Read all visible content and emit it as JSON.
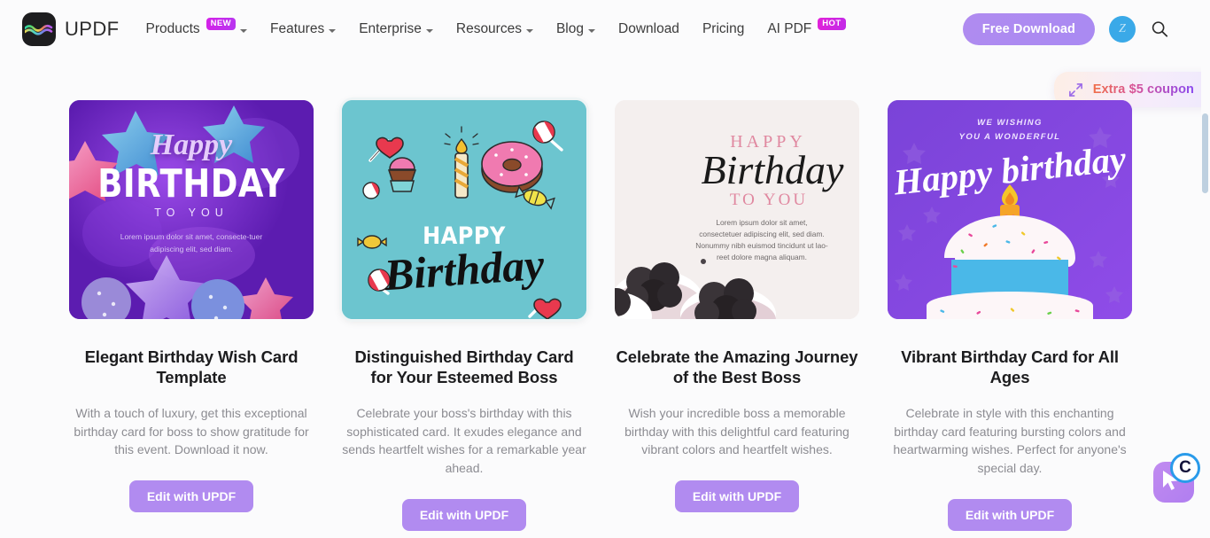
{
  "header": {
    "brand_name": "UPDF",
    "logo_icon": "updf-logo-icon",
    "nav": [
      {
        "label": "Products",
        "badge": "NEW",
        "badge_type": "new",
        "has_caret": true
      },
      {
        "label": "Features",
        "badge": null,
        "badge_type": null,
        "has_caret": true
      },
      {
        "label": "Enterprise",
        "badge": null,
        "badge_type": null,
        "has_caret": true
      },
      {
        "label": "Resources",
        "badge": null,
        "badge_type": null,
        "has_caret": true
      },
      {
        "label": "Blog",
        "badge": null,
        "badge_type": null,
        "has_caret": true
      },
      {
        "label": "Download",
        "badge": null,
        "badge_type": null,
        "has_caret": false
      },
      {
        "label": "Pricing",
        "badge": null,
        "badge_type": null,
        "has_caret": false
      },
      {
        "label": "AI PDF",
        "badge": "HOT",
        "badge_type": "hot",
        "has_caret": false
      }
    ],
    "download_button": "Free Download",
    "avatar_initial": "Z",
    "search_icon": "search-icon",
    "accent_purple": "#b08bf0",
    "avatar_blue": "#3aa9e8"
  },
  "coupon": {
    "label": "Extra $5 coupon",
    "icon": "expand-arrows-icon"
  },
  "cards": [
    {
      "title": "Elegant Birthday Wish Card Template",
      "description": "With a touch of luxury, get this exceptional birthday card for boss to show gratitude for this event. Download it now.",
      "button": "Edit with UPDF",
      "selected": false,
      "art": {
        "style": "purple-stars-balloons",
        "bg_color": "#6822be",
        "line1": "Happy",
        "line2": "BIRTHDAY",
        "line3": "TO YOU",
        "body": "Lorem ipsum dolor sit amet, consecte-tuer adipiscing elit, sed diam."
      }
    },
    {
      "title": "Distinguished Birthday Card for Your Esteemed Boss",
      "description": "Celebrate your boss's birthday with this sophisticated card. It exudes elegance and sends heartfelt wishes for a remarkable year ahead.",
      "button": "Edit with UPDF",
      "selected": true,
      "art": {
        "style": "teal-candy-doodles",
        "bg_color": "#6cc5cf",
        "line1": "HAPPY",
        "line2": "Birthday"
      }
    },
    {
      "title": "Celebrate the Amazing Journey of the Best Boss",
      "description": "Wish your incredible boss a memorable birthday with this delightful card featuring vibrant colors and heartfelt wishes.",
      "button": "Edit with UPDF",
      "selected": false,
      "art": {
        "style": "cream-chocolate-cupcakes",
        "bg_color": "#f4efee",
        "line1": "HAPPY",
        "line2": "Birthday",
        "line3": "TO YOU",
        "body1": "Lorem ipsum dolor sit amet, consectetuer adipiscing elit, sed diam.",
        "body2": "Nonummy nibh euismod tincidunt ut lao-reet dolore magna aliquam."
      }
    },
    {
      "title": "Vibrant Birthday Card for All Ages",
      "description": "Celebrate in style with this enchanting birthday card featuring bursting colors and heartwarming wishes. Perfect for anyone's special day.",
      "button": "Edit with UPDF",
      "selected": false,
      "art": {
        "style": "purple-cake-candle",
        "bg_color": "#7a3fd4",
        "line1": "WE WISHING",
        "line2": "YOU A WONDERFUL",
        "line3": "Happy birthday"
      }
    }
  ],
  "floating_widget": {
    "icon": "cursor-icon",
    "badge_letter": "C"
  },
  "scrollbar": {
    "icon": "vertical-scrollbar"
  }
}
